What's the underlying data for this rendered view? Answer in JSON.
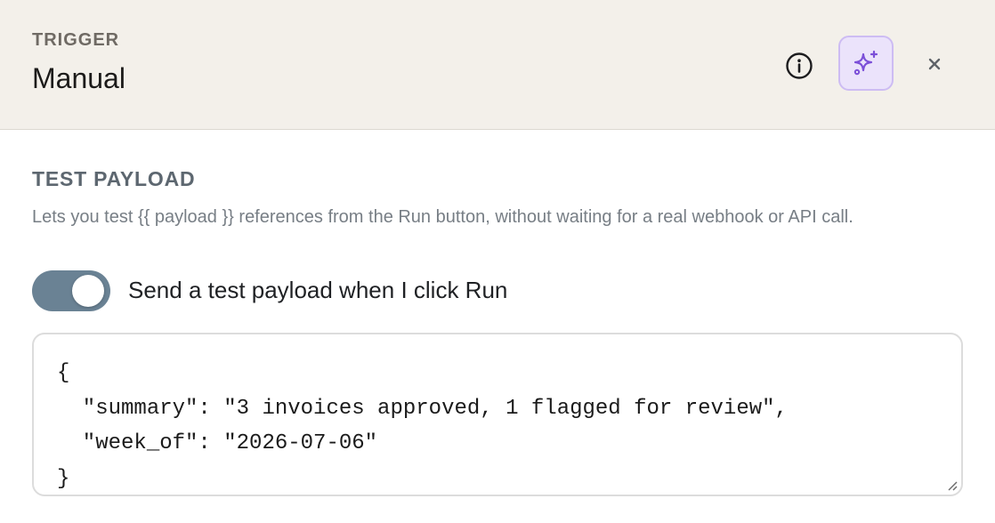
{
  "header": {
    "eyebrow": "TRIGGER",
    "title": "Manual",
    "buttons": {
      "info_icon": "info-circle-icon",
      "ai_icon": "sparkle-icon",
      "close_icon": "close-icon",
      "ai_accent": "#7b4fd8"
    }
  },
  "section": {
    "title": "TEST PAYLOAD",
    "description": "Lets you test {{ payload }} references from the Run button, without waiting for a real webhook or API call."
  },
  "toggle": {
    "checked": true,
    "label": "Send a test payload when I click Run",
    "color": "#6a8294"
  },
  "editor": {
    "value": "{\n  \"summary\": \"3 invoices approved, 1 flagged for review\",\n  \"week_of\": \"2026-07-06\"\n}"
  }
}
